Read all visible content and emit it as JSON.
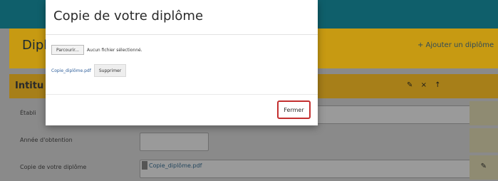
{
  "background": {
    "title_partial": "Dipl",
    "add_diploma_link": "+ Ajouter un diplôme",
    "section_label": "Intitu",
    "form_rows": [
      {
        "label": "Établi",
        "value": ""
      },
      {
        "label": "Année d'obtention",
        "value": ""
      },
      {
        "label": "Copie de votre diplôme",
        "value": "Copie_diplôme.pdf"
      }
    ]
  },
  "modal": {
    "title": "Copie de votre diplôme",
    "browse_label": "Parcourir...",
    "file_status": "Aucun fichier sélectionné.",
    "uploaded_file": "Copie_diplôme.pdf",
    "delete_label": "Supprimer",
    "close_label": "Fermer"
  },
  "colors": {
    "header": "#0f5f6b",
    "title_bar": "#c79a12",
    "section_bar": "#a77f19",
    "close_border": "#c33030"
  },
  "icons": {
    "edit": "pencil-icon",
    "delete": "close-icon",
    "upload": "arrow-up-icon",
    "document": "file-icon"
  }
}
